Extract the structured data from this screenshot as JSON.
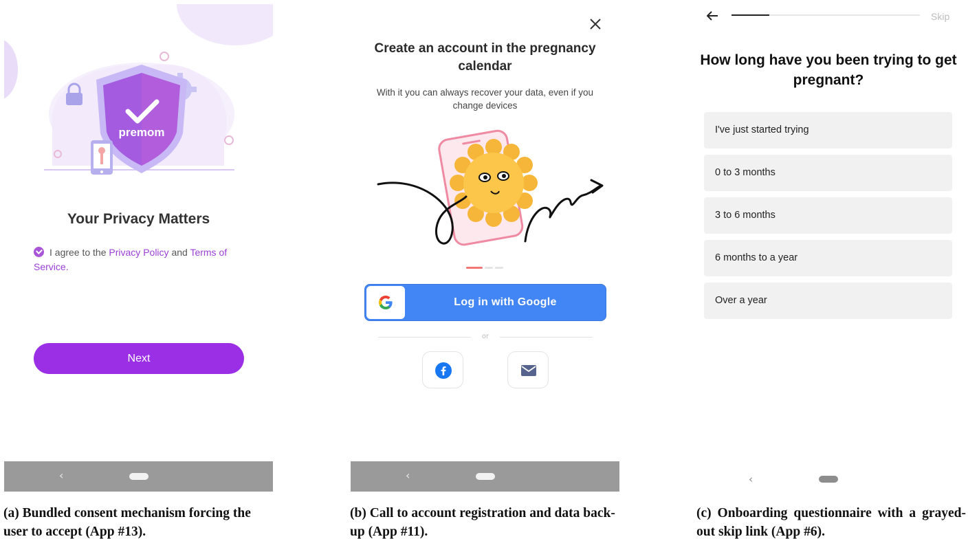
{
  "panel_a": {
    "logo_text": "premom",
    "title": "Your Privacy Matters",
    "consent": {
      "prefix": "I agree to the",
      "privacy_link": "Privacy Policy",
      "middle": "and",
      "terms_link": "Terms of Service",
      "suffix": "."
    },
    "next_button": "Next",
    "nav": {
      "back": "‹"
    },
    "colors": {
      "accent": "#9a2fe6",
      "link": "#9b3fd6"
    }
  },
  "panel_b": {
    "title": "Create an account in the pregnancy calendar",
    "subtitle": "With it you can always recover your data, even if you change devices",
    "google_button": "Log in with Google",
    "divider_text": "or",
    "social": [
      {
        "icon": "facebook-icon"
      },
      {
        "icon": "email-icon"
      }
    ],
    "nav": {
      "back": "‹"
    },
    "colors": {
      "google_blue": "#4285f4",
      "pager_active": "#f27777"
    }
  },
  "panel_c": {
    "skip": "Skip",
    "progress": 0.2,
    "question": "How long have you been trying to get pregnant?",
    "options": [
      "I've just started trying",
      "0 to 3 months",
      "3 to 6 months",
      "6 months to a year",
      "Over a year"
    ],
    "nav": {
      "back": "‹"
    }
  },
  "captions": {
    "a": "(a) Bundled consent mechanism forcing the user to accept (App #13).",
    "b": "(b) Call to account registration and data back-up (App #11).",
    "c": "(c) Onboarding questionnaire with a grayed-out skip link (App #6)."
  }
}
